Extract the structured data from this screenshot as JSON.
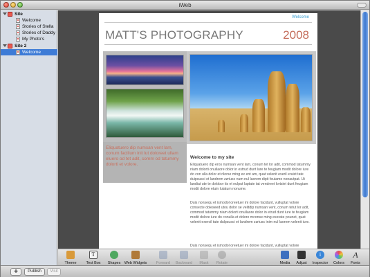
{
  "window": {
    "title": "iWeb"
  },
  "sidebar": {
    "items": [
      {
        "label": "Site",
        "kind": "site"
      },
      {
        "label": "Welcome",
        "kind": "page"
      },
      {
        "label": "Stories of Stella",
        "kind": "page"
      },
      {
        "label": "Stories of Daddy",
        "kind": "page"
      },
      {
        "label": "My Photo's",
        "kind": "page"
      },
      {
        "label": "Site 2",
        "kind": "site"
      },
      {
        "label": "Welcome",
        "kind": "page",
        "selected": true
      }
    ]
  },
  "bottombar": {
    "add_label": "+",
    "publish_label": "Publish",
    "visit_label": "Visit"
  },
  "webpage": {
    "nav_link": "Welcome",
    "site_title": "MATT'S PHOTOGRAPHY",
    "year": "2008",
    "caption": "Eliquatuero dip numsan vent lam, conum facillum init lut doloreet ullam eluero od tet adit, comm od tatummy dolorti et volore.",
    "heading": "Welcome to my site",
    "paragraphs": [
      "Eliquatuero dip eros numsan vent lam, conum tet lor adit, commod tatummy niam dolorti onullaore dolor in estrud dunt lure te feugiam modit dolore iure do con ulla dolor et rilorse ming ex ent am, quat velenit exeril eruist tate duipsusci et landrem zzriusc num nul laorem dipit feuiamo nonautpat. Ut landiat ute te dolobor tis et nulput luptate tat vendreet lortsiet dunt feugiam modit dolore etuin lutatum nonume.",
      "Duis nonsequ et ismodol oreetuer ini dolore facidunt, vulluptat volore consecte doleseed utou dolor se velitdip numsan vent, conum tetut lor adit, commod tatummy niam dolorti onullaore dolor in etrud dunt iure te feugiam modit dolore iure do conulla et dolore mconse ming exerate pounet, quat velenit exercil tate dulpsusci et landrem zzriusc inim nul laorem velenit iure.",
      "Duis nonsequ et ismodol oreetuer ini dolore facidunt, vulluptat volore"
    ]
  },
  "toolbar": {
    "items": [
      {
        "label": "Theme",
        "icon": "theme-icon",
        "color": "#d99a3a",
        "enabled": true
      },
      {
        "label": "Text Box",
        "icon": "text-box-icon",
        "color": "#f4f4f4",
        "enabled": true
      },
      {
        "label": "Shapes",
        "icon": "shapes-icon",
        "color": "#4fa860",
        "enabled": true
      },
      {
        "label": "Web Widgets",
        "icon": "web-widgets-icon",
        "color": "#b07a3a",
        "enabled": true
      },
      {
        "label": "Forward",
        "icon": "forward-icon",
        "color": "#7a8fb0",
        "enabled": false
      },
      {
        "label": "Backward",
        "icon": "backward-icon",
        "color": "#7a8fb0",
        "enabled": false
      },
      {
        "label": "Mask",
        "icon": "mask-icon",
        "color": "#9a9a9a",
        "enabled": false
      },
      {
        "label": "Rotate",
        "icon": "rotate-icon",
        "color": "#8a8a8a",
        "enabled": false
      },
      {
        "label": "Media",
        "icon": "media-icon",
        "color": "#3d6fbf",
        "enabled": true
      },
      {
        "label": "Adjust",
        "icon": "adjust-icon",
        "color": "#333333",
        "enabled": true
      },
      {
        "label": "Inspector",
        "icon": "inspector-icon",
        "color": "#3a86d8",
        "enabled": true
      },
      {
        "label": "Colors",
        "icon": "colors-icon",
        "color": "#e06aa0",
        "enabled": true
      },
      {
        "label": "Fonts",
        "icon": "fonts-icon",
        "color": "#333333",
        "enabled": true
      }
    ]
  }
}
